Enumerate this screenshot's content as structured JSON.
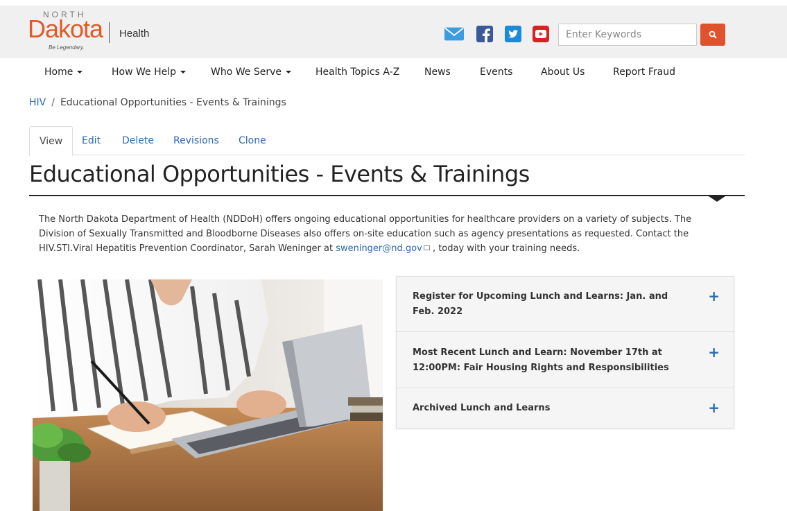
{
  "logo": {
    "north": "NORTH",
    "dakota": "Dakota",
    "health": "Health",
    "tagline": "Be Legendary."
  },
  "social": [
    "mail-icon",
    "facebook-icon",
    "twitter-icon",
    "youtube-icon"
  ],
  "search": {
    "placeholder": "Enter Keywords"
  },
  "nav": {
    "items": [
      {
        "label": "Home",
        "dropdown": true
      },
      {
        "label": "How We Help",
        "dropdown": true
      },
      {
        "label": "Who We Serve",
        "dropdown": true
      },
      {
        "label": "Health Topics A-Z",
        "dropdown": false
      },
      {
        "label": "News",
        "dropdown": false
      },
      {
        "label": "Events",
        "dropdown": false
      },
      {
        "label": "About Us",
        "dropdown": false
      },
      {
        "label": "Report Fraud",
        "dropdown": false
      }
    ]
  },
  "breadcrumb": {
    "parent": "HIV",
    "separator": "/",
    "current": "Educational Opportunities - Events & Trainings"
  },
  "tabs": [
    {
      "label": "View",
      "active": true
    },
    {
      "label": "Edit",
      "active": false
    },
    {
      "label": "Delete",
      "active": false
    },
    {
      "label": "Revisions",
      "active": false
    },
    {
      "label": "Clone",
      "active": false
    }
  ],
  "page": {
    "title": "Educational Opportunities - Events & Trainings",
    "intro_before": "The North Dakota Department of Health (NDDoH) offers ongoing educational opportunities for healthcare providers on a variety of subjects.  The Division of Sexually Transmitted and Bloodborne Diseases also offers on-site education such as agency presentations as requested.  Contact the HIV.STI.Viral Hepatitis Prevention Coordinator, Sarah Weninger at ",
    "intro_email": "sweninger@nd.gov",
    "intro_after": " , today with your training needs."
  },
  "accordion": {
    "items": [
      {
        "title": "Register for Upcoming Lunch and Learns: Jan. and Feb. 2022",
        "icon": "+"
      },
      {
        "title": "Most Recent Lunch and Learn: November 17th at 12:00PM: Fair Housing Rights and Responsibilities",
        "icon": "+"
      },
      {
        "title": "Archived Lunch and Learns",
        "icon": "+"
      }
    ]
  },
  "colors": {
    "brand_orange": "#e05a2a",
    "link_blue": "#2a6ab0",
    "search_button": "#e0522e"
  }
}
